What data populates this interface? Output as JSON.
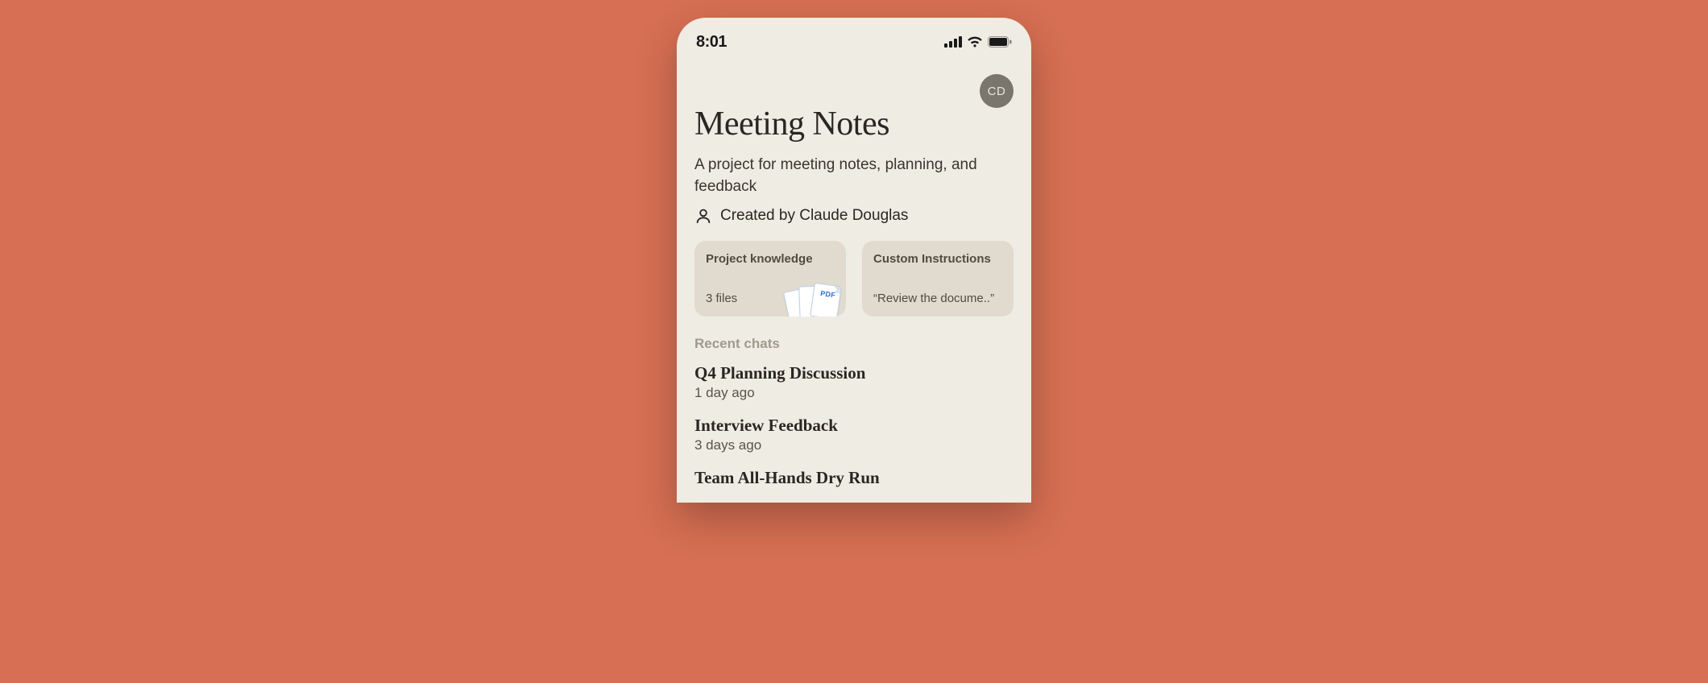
{
  "status": {
    "time": "8:01"
  },
  "avatar": {
    "initials": "CD"
  },
  "project": {
    "title": "Meeting Notes",
    "description": "A project for meeting notes, planning, and feedback",
    "creator_label": "Created by Claude Douglas"
  },
  "cards": {
    "knowledge": {
      "title": "Project knowledge",
      "sub": "3 files",
      "badge": "PDF"
    },
    "instructions": {
      "title": "Custom Instructions",
      "preview": "“Review the docume..”"
    }
  },
  "recent": {
    "label": "Recent chats",
    "items": [
      {
        "title": "Q4 Planning Discussion",
        "ago": "1 day ago"
      },
      {
        "title": "Interview Feedback",
        "ago": "3 days ago"
      },
      {
        "title": "Team All-Hands Dry Run",
        "ago": ""
      }
    ]
  }
}
